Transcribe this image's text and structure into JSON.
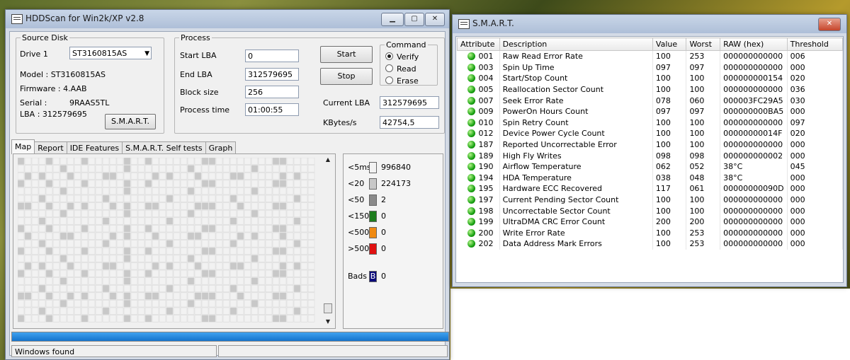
{
  "hddscan": {
    "title": "HDDScan for Win2k/XP  v2.8",
    "controls": {
      "minimize": "▁",
      "maximize": "▢",
      "close": "✕"
    },
    "source_disk": {
      "legend": "Source Disk",
      "drive_label": "Drive  1",
      "drive_value": "ST3160815AS",
      "model": "Model : ST3160815AS",
      "firmware": "Firmware : 4.AAB",
      "serial_label": "Serial :",
      "serial_value": "9RAAS5TL",
      "lba": "LBA :  312579695",
      "smart_button": "S.M.A.R.T."
    },
    "process": {
      "legend": "Process",
      "start_lba_label": "Start LBA",
      "start_lba": "0",
      "end_lba_label": "End LBA",
      "end_lba": "312579695",
      "block_size_label": "Block size",
      "block_size": "256",
      "process_time_label": "Process time",
      "process_time": "01:00:55",
      "start_button": "Start",
      "stop_button": "Stop",
      "current_lba_label": "Current LBA",
      "current_lba": "312579695",
      "kbytes_label": "KBytes/s",
      "kbytes": "42754,5"
    },
    "command": {
      "legend": "Command",
      "options": [
        "Verify",
        "Read",
        "Erase"
      ],
      "selected": "Verify"
    },
    "tabs": [
      "Map",
      "Report",
      "IDE Features",
      "S.M.A.R.T. Self tests",
      "Graph"
    ],
    "legend_rows": [
      {
        "label": "<5ms",
        "value": "996840",
        "color": "#f2f2f2"
      },
      {
        "label": "<20",
        "value": "224173",
        "color": "#c8c8c8"
      },
      {
        "label": "<50",
        "value": "2",
        "color": "#8a8a8a"
      },
      {
        "label": "<150",
        "value": "0",
        "color": "#1e7d1e"
      },
      {
        "label": "<500",
        "value": "0",
        "color": "#f08a12"
      },
      {
        "label": ">500",
        "value": "0",
        "color": "#e01010"
      }
    ],
    "bads": {
      "label": "Bads",
      "badge": "B",
      "value": "0",
      "color": "#0a0a7a"
    },
    "progress": 1.0,
    "status": "Windows found"
  },
  "smart": {
    "title": "S.M.A.R.T.",
    "close": "✕",
    "headers": [
      "Attribute",
      "Description",
      "Value",
      "Worst",
      "RAW (hex)",
      "Threshold"
    ],
    "rows": [
      [
        "001",
        "Raw Read Error Rate",
        "100",
        "253",
        "000000000000",
        "006"
      ],
      [
        "003",
        "Spin Up Time",
        "097",
        "097",
        "000000000000",
        "000"
      ],
      [
        "004",
        "Start/Stop Count",
        "100",
        "100",
        "000000000154",
        "020"
      ],
      [
        "005",
        "Reallocation Sector Count",
        "100",
        "100",
        "000000000000",
        "036"
      ],
      [
        "007",
        "Seek Error Rate",
        "078",
        "060",
        "000003FC29A5",
        "030"
      ],
      [
        "009",
        "PowerOn Hours Count",
        "097",
        "097",
        "000000000BA5",
        "000"
      ],
      [
        "010",
        "Spin Retry Count",
        "100",
        "100",
        "000000000000",
        "097"
      ],
      [
        "012",
        "Device Power Cycle Count",
        "100",
        "100",
        "00000000014F",
        "020"
      ],
      [
        "187",
        "Reported Uncorrectable Error",
        "100",
        "100",
        "000000000000",
        "000"
      ],
      [
        "189",
        "High Fly Writes",
        "098",
        "098",
        "000000000002",
        "000"
      ],
      [
        "190",
        "Airflow Temperature",
        "062",
        "052",
        "38°C",
        "045"
      ],
      [
        "194",
        "HDA Temperature",
        "038",
        "048",
        "38°C",
        "000"
      ],
      [
        "195",
        "Hardware ECC Recovered",
        "117",
        "061",
        "00000000090D",
        "000"
      ],
      [
        "197",
        "Current Pending Sector Count",
        "100",
        "100",
        "000000000000",
        "000"
      ],
      [
        "198",
        "Uncorrectable Sector Count",
        "100",
        "100",
        "000000000000",
        "000"
      ],
      [
        "199",
        "UltraDMA CRC Error Count",
        "200",
        "200",
        "000000000000",
        "000"
      ],
      [
        "200",
        "Write Error Rate",
        "100",
        "253",
        "000000000000",
        "000"
      ],
      [
        "202",
        "Data Address Mark Errors",
        "100",
        "253",
        "000000000000",
        "000"
      ]
    ]
  }
}
